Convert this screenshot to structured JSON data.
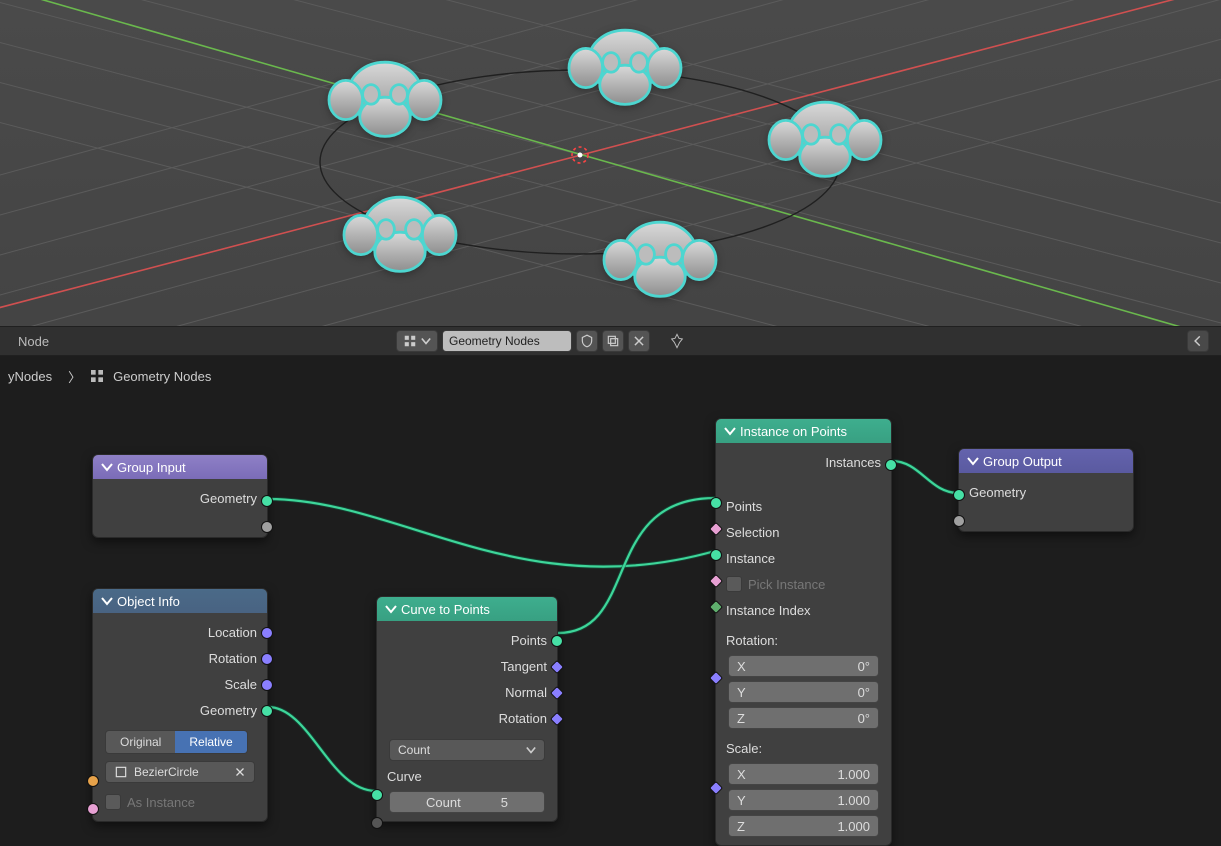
{
  "viewport": {
    "alt": "3D viewport with circle curve and 5 monkey instances"
  },
  "toolbar": {
    "left_label": "Node",
    "tree_name": "Geometry Nodes"
  },
  "breadcrumb": {
    "a": "yNodes",
    "b": "Geometry Nodes"
  },
  "nodes": {
    "group_input": {
      "title": "Group Input",
      "out0": "Geometry"
    },
    "object_info": {
      "title": "Object Info",
      "out_location": "Location",
      "out_rotation": "Rotation",
      "out_scale": "Scale",
      "out_geometry": "Geometry",
      "toggle_original": "Original",
      "toggle_relative": "Relative",
      "obj_name": "BezierCircle",
      "as_instance": "As Instance"
    },
    "curve_to_points": {
      "title": "Curve to Points",
      "out_points": "Points",
      "out_tangent": "Tangent",
      "out_normal": "Normal",
      "out_rotation": "Rotation",
      "mode": "Count",
      "in_curve": "Curve",
      "count_label": "Count",
      "count_value": "5"
    },
    "instance_on_points": {
      "title": "Instance on Points",
      "out_instances": "Instances",
      "in_points": "Points",
      "in_selection": "Selection",
      "in_instance": "Instance",
      "pick_instance": "Pick Instance",
      "instance_index": "Instance Index",
      "rotation_label": "Rotation:",
      "rx_label": "X",
      "rx_val": "0°",
      "ry_label": "Y",
      "ry_val": "0°",
      "rz_label": "Z",
      "rz_val": "0°",
      "scale_label": "Scale:",
      "sx_label": "X",
      "sx_val": "1.000",
      "sy_label": "Y",
      "sy_val": "1.000",
      "sz_label": "Z",
      "sz_val": "1.000"
    },
    "group_output": {
      "title": "Group Output",
      "in_geometry": "Geometry"
    }
  }
}
